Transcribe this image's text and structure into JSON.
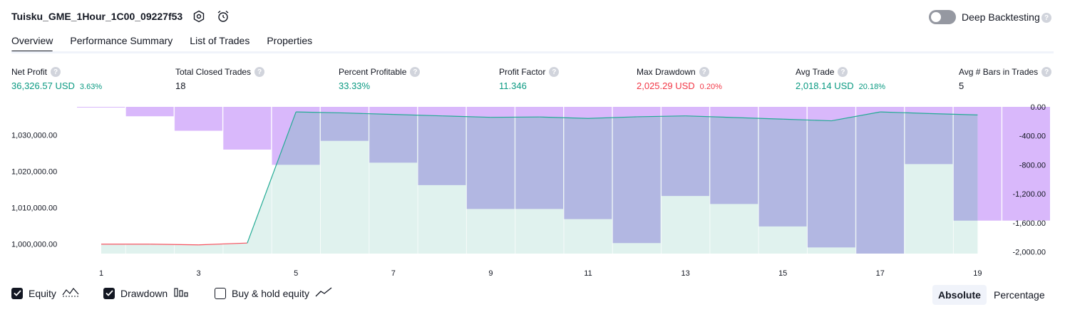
{
  "header": {
    "title": "Tuisku_GME_1Hour_1C00_09227f53",
    "deep_backtesting_label": "Deep Backtesting"
  },
  "tabs": [
    {
      "label": "Overview",
      "active": true
    },
    {
      "label": "Performance Summary",
      "active": false
    },
    {
      "label": "List of Trades",
      "active": false
    },
    {
      "label": "Properties",
      "active": false
    }
  ],
  "stats": {
    "net_profit": {
      "label": "Net Profit",
      "value": "36,326.57 USD",
      "pct": "3.63%"
    },
    "total_closed_trades": {
      "label": "Total Closed Trades",
      "value": "18"
    },
    "percent_profitable": {
      "label": "Percent Profitable",
      "value": "33.33%"
    },
    "profit_factor": {
      "label": "Profit Factor",
      "value": "11.346"
    },
    "max_drawdown": {
      "label": "Max Drawdown",
      "value": "2,025.29 USD",
      "pct": "0.20%"
    },
    "avg_trade": {
      "label": "Avg Trade",
      "value": "2,018.14 USD",
      "pct": "20.18%"
    },
    "avg_bars": {
      "label": "Avg # Bars in Trades",
      "value": "5"
    }
  },
  "chart_data": {
    "type": "area",
    "x_ticks": [
      "1",
      "3",
      "5",
      "7",
      "9",
      "11",
      "13",
      "15",
      "17",
      "19"
    ],
    "left_axis_ticks": [
      "1,030,000.00",
      "1,020,000.00",
      "1,010,000.00",
      "1,000,000.00"
    ],
    "right_axis_ticks": [
      "0.00",
      "-400.00",
      "-800.00",
      "-1,200.00",
      "-1,600.00",
      "-2,000.00"
    ],
    "equity": {
      "x": [
        1,
        2,
        3,
        4,
        5,
        6,
        7,
        8,
        9,
        10,
        11,
        12,
        13,
        14,
        15,
        16,
        17,
        18,
        19
      ],
      "y": [
        1000000,
        1000000,
        999800,
        1000300,
        1036330,
        1036050,
        1035650,
        1035250,
        1034850,
        1034950,
        1034550,
        1035000,
        1035250,
        1034800,
        1034350,
        1033900,
        1036330,
        1035900,
        1035500
      ]
    },
    "drawdown": {
      "x": [
        1,
        2,
        3,
        4,
        5,
        6,
        7,
        8,
        9,
        10,
        11,
        12,
        13,
        14,
        15,
        16,
        17,
        18,
        19,
        20
      ],
      "y": [
        -5,
        -130,
        -330,
        -590,
        -800,
        -470,
        -770,
        -1080,
        -1410,
        -1410,
        -1550,
        -1880,
        -1230,
        -1340,
        -1650,
        -1940,
        -2025,
        -790,
        -1570,
        -1570
      ]
    },
    "left_range": [
      997400,
      1037730
    ],
    "right_range": [
      -2025,
      0
    ],
    "colors": {
      "equity_up_line": "#22ab94",
      "equity_down_line": "#f7525f",
      "equity_fill": "#e0f2ee",
      "drawdown_fill": "#d9b8fb",
      "overlap_fill": "#b2b7e2"
    }
  },
  "legend": {
    "equity": {
      "label": "Equity",
      "checked": true
    },
    "drawdown": {
      "label": "Drawdown",
      "checked": true
    },
    "buy_hold": {
      "label": "Buy & hold equity",
      "checked": false
    }
  },
  "mode": {
    "absolute": "Absolute",
    "percentage": "Percentage",
    "selected": "absolute"
  }
}
